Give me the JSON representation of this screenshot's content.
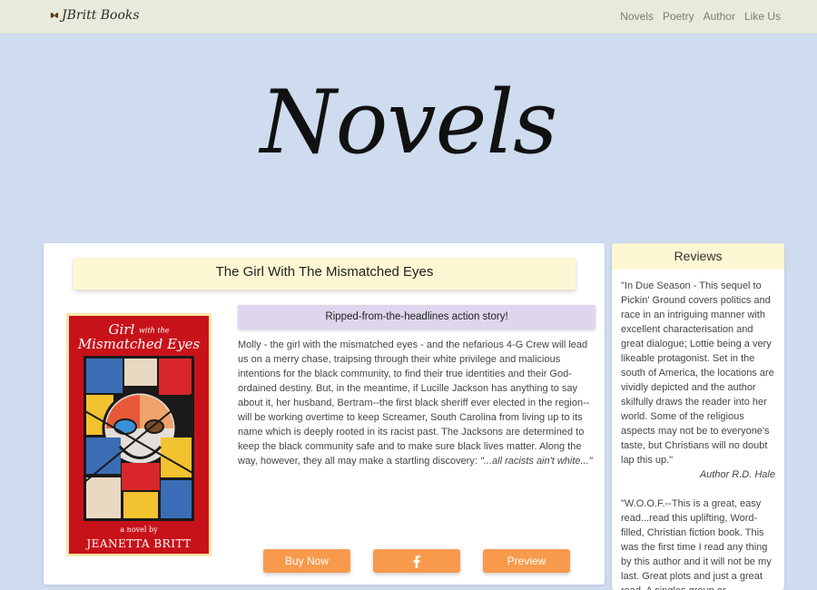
{
  "nav": {
    "brand": "JBritt Books",
    "links": [
      "Novels",
      "Poetry",
      "Author",
      "Like Us"
    ]
  },
  "hero": {
    "title": "Novels"
  },
  "book": {
    "title": "The Girl With The Mismatched Eyes",
    "tagline": "Ripped-from-the-headlines action story!",
    "description": "Molly - the girl with the mismatched eyes - and the nefarious 4-G Crew will lead us on a merry chase, traipsing through their white privilege and malicious intentions for the black community, to find their true identities and their God-ordained destiny. But, in the meantime, if Lucille Jackson has anything to say about it, her husband, Bertram--the first black sheriff ever elected in the region--will be working overtime to keep Screamer, South Carolina from living up to its name which is deeply rooted in its racist past. The Jacksons are determined to keep the black community safe and to make sure black lives matter. Along the way, however, they all may make a startling discovery: ",
    "description_quote": "\"...all racists ain't white...\"",
    "cover": {
      "title_line1": "Girl",
      "title_small": "with the",
      "title_line2": "Mismatched Eyes",
      "subtitle": "a novel by",
      "author": "JEANETTA BRITT"
    },
    "buttons": {
      "buy": "Buy Now",
      "facebook_icon": "facebook-icon",
      "preview": "Preview"
    }
  },
  "reviews": {
    "heading": "Reviews",
    "items": [
      {
        "text": "\"In Due Season - This sequel to Pickin' Ground covers politics and race in an intriguing manner with excellent characterisation and great dialogue; Lottie being a very likeable protagonist. Set in the south of America, the locations are vividly depicted and the author skilfully draws the reader into her world. Some of the religious aspects may not be to everyone's taste, but Christians will no doubt lap this up.\"",
        "author": "Author R.D. Hale"
      },
      {
        "text": "\"W.O.O.F.--This is a great, easy read...read this uplifting, Word-filled, Christian fiction book. This was the first time I read any thing by this author and it will not be my last. Great plots and just a great read. A singles group or",
        "author": ""
      }
    ]
  },
  "colors": {
    "background": "#cfdcef",
    "navbar": "#e8ebdb",
    "accent_button": "#f89a4c",
    "title_box": "#fdf7d3",
    "tagline_box": "#ddd6ec",
    "cover_red": "#c8121a"
  }
}
